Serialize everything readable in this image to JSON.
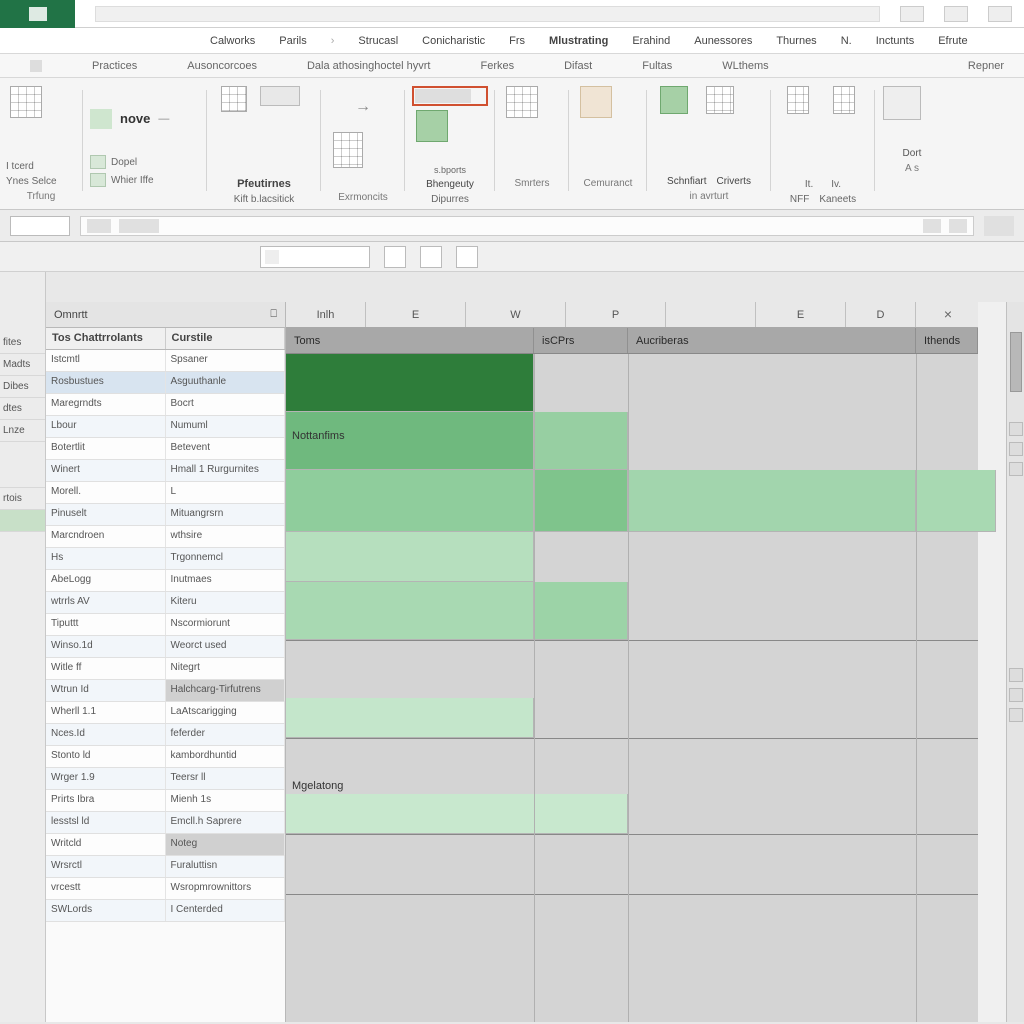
{
  "tabs": {
    "main": [
      "Calworks",
      "Parils",
      "Strucasl",
      "Conicharistic",
      "Frs",
      "Mlustrating",
      "Erahind",
      "Aunessores",
      "Thurnes",
      "N.",
      "Inctunts",
      "Efrute"
    ],
    "sub": [
      "Practices",
      "Ausoncorcoes",
      "Dala athosinghoctel hyvrt",
      "Ferkes",
      "Difast",
      "Fultas",
      "WLthems",
      "Repner"
    ]
  },
  "ribbon": {
    "g1": {
      "items": [
        "I tcerd",
        "Ynes Selce"
      ],
      "label": "Trfung"
    },
    "g2": {
      "title": "nove",
      "items": [
        "Dopel",
        "Whier Iffe"
      ],
      "label": ""
    },
    "g3": {
      "l1": "Pfeutirnes",
      "l2": "Kift b.lacsitick",
      "label": ""
    },
    "g4": {
      "label": "Exrmoncits"
    },
    "g5": {
      "t": "s.bports",
      "l1": "Bhengeuty",
      "l2": "Dipurres"
    },
    "g6": {
      "label": "Smrters"
    },
    "g7": {
      "label": "Cemuranct"
    },
    "g8": {
      "l1": "Schnfiart",
      "l2": "Criverts"
    },
    "g9": {
      "label": "in avrturt"
    },
    "g10": {
      "l1": "It.",
      "l2": "NFF"
    },
    "g11": {
      "l1": "Iv.",
      "l2": "Kaneets"
    },
    "g12": {
      "l1": "Dort",
      "l2": "A s"
    }
  },
  "leftcol": [
    "fites",
    "Madts",
    "Dibes",
    "dtes",
    "Lnze",
    "rtois"
  ],
  "panel": {
    "header": "Omnrtt",
    "col1": "Tos Chattrrolants",
    "col2": "Curstile",
    "rows": [
      {
        "a": "Istcmtl",
        "b": "Spsaner"
      },
      {
        "a": "Rosbustues",
        "b": "Asguuthanle"
      },
      {
        "a": "Maregrndts",
        "b": "Bocrt"
      },
      {
        "a": "Lbour",
        "b": "Numuml"
      },
      {
        "a": "Botertlit",
        "b": "Betevent"
      },
      {
        "a": "Winert",
        "b": "Hmall 1 Rurgurnites"
      },
      {
        "a": "Morell.",
        "b": "L"
      },
      {
        "a": "Pinuselt",
        "b": "Mituangrsrn"
      },
      {
        "a": "Marcndroen",
        "b": "wthsire"
      },
      {
        "a": "Hs",
        "b": "Trgonnemcl"
      },
      {
        "a": "AbeLogg",
        "b": "Inutmaes"
      },
      {
        "a": "wtrrls AV",
        "b": "Kiteru"
      },
      {
        "a": "Tiputtt",
        "b": "Nscormiorunt"
      },
      {
        "a": "Winso.1d",
        "b": "Weorct used"
      },
      {
        "a": "Witle ff",
        "b": "Nitegrt"
      },
      {
        "a": "Wtrun Id",
        "b": "Halchcarg-Tirfutrens"
      },
      {
        "a": "Wherll 1.1",
        "b": "LaAtscarigging"
      },
      {
        "a": "Nces.Id",
        "b": "feferder"
      },
      {
        "a": "Stonto ld",
        "b": "kambordhuntid"
      },
      {
        "a": "Wrger 1.9",
        "b": "Teersr ll"
      },
      {
        "a": "Prirts Ibra",
        "b": "Mienh 1s"
      },
      {
        "a": "lesstsl ld",
        "b": "Emcll.h Saprere"
      },
      {
        "a": "Writcld",
        "b": "Noteg"
      },
      {
        "a": "Wrsrctl",
        "b": "Furaluttisn"
      },
      {
        "a": "vrcestt",
        "b": "Wsropmrownittors"
      },
      {
        "a": "SWLords",
        "b": "I Centerded"
      }
    ]
  },
  "grid": {
    "cols": [
      "Inlh",
      "E",
      "W",
      "P",
      "",
      "E",
      "D"
    ],
    "subcols": [
      "Toms",
      "isCPrs",
      "Aucriberas",
      "Ithends"
    ],
    "rowlabels": [
      "Nottanfims",
      "Mgelatong"
    ]
  },
  "colors": {
    "dark_green": "#2e7d3a",
    "mid_green": "#6fb97e",
    "light_green": "#97cfa2",
    "pale_green": "#bde0c4"
  }
}
